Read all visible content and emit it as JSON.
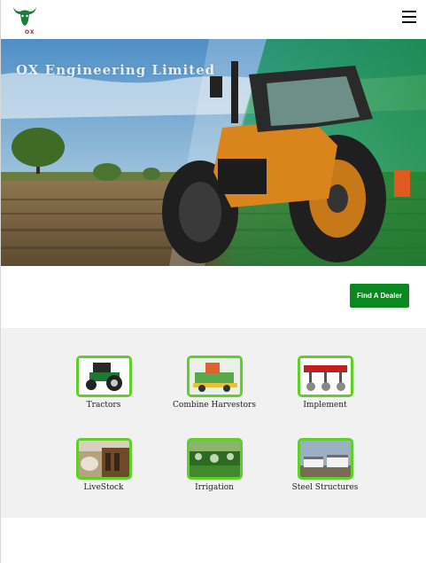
{
  "header": {
    "logo_text": "OX",
    "menu_icon": "hamburger-menu-icon"
  },
  "hero": {
    "title": "OX Engineering Limited"
  },
  "actions": {
    "find_dealer": "Find A Dealer"
  },
  "categories": [
    {
      "label": "Tractors",
      "icon": "tractor-image"
    },
    {
      "label": "Combine Harvestors",
      "icon": "combine-harvester-image"
    },
    {
      "label": "Implement",
      "icon": "implement-image"
    },
    {
      "label": "LiveStock",
      "icon": "livestock-image"
    },
    {
      "label": "Irrigation",
      "icon": "irrigation-image"
    },
    {
      "label": "Steel Structures",
      "icon": "steel-structures-image"
    }
  ],
  "colors": {
    "accent_green": "#0a8a1e",
    "thumb_border": "#5fd02a",
    "logo_red": "#c8202a",
    "logo_green": "#1a7d3a"
  }
}
